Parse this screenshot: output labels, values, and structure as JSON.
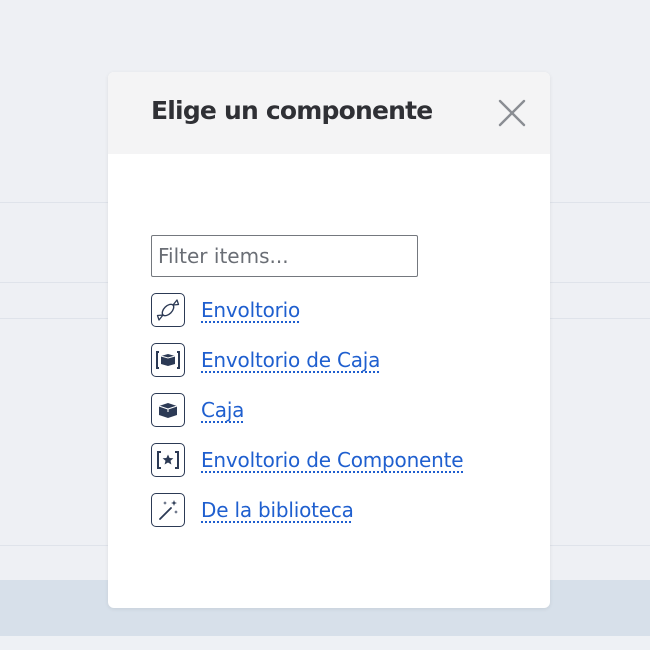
{
  "modal": {
    "title": "Elige un componente",
    "close_icon": "close-icon"
  },
  "filter": {
    "placeholder": "Filter items...",
    "value": ""
  },
  "items": [
    {
      "label": "Envoltorio",
      "icon": "wrapper-icon"
    },
    {
      "label": "Envoltorio de Caja",
      "icon": "box-wrapper-icon"
    },
    {
      "label": "Caja",
      "icon": "box-icon"
    },
    {
      "label": "Envoltorio de Componente",
      "icon": "component-wrapper-icon"
    },
    {
      "label": "De la biblioteca",
      "icon": "magic-wand-icon"
    }
  ],
  "colors": {
    "link": "#1f5fcf",
    "icon_stroke": "#2c3a55",
    "header_bg": "#f4f4f5",
    "page_bg": "#eef0f4"
  }
}
